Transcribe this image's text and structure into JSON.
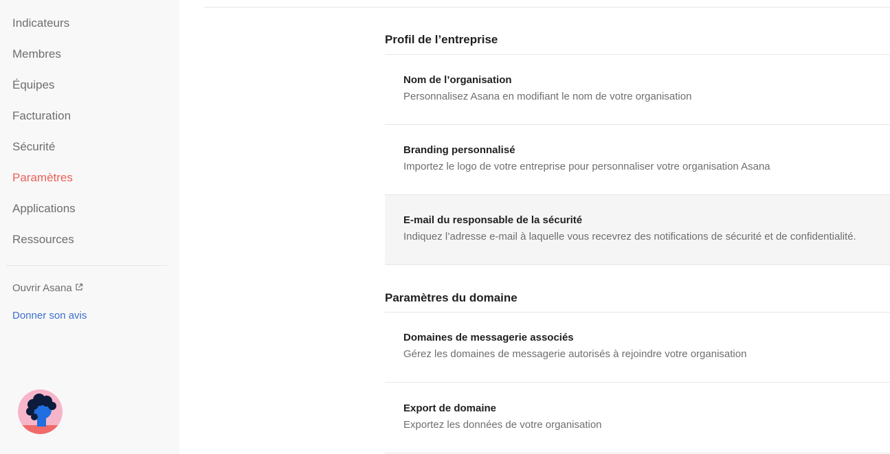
{
  "sidebar": {
    "items": [
      {
        "label": "Indicateurs",
        "active": false
      },
      {
        "label": "Membres",
        "active": false
      },
      {
        "label": "Équipes",
        "active": false
      },
      {
        "label": "Facturation",
        "active": false
      },
      {
        "label": "Sécurité",
        "active": false
      },
      {
        "label": "Paramètres",
        "active": true
      },
      {
        "label": "Applications",
        "active": false
      },
      {
        "label": "Ressources",
        "active": false
      }
    ],
    "open_link": "Ouvrir Asana",
    "feedback_link": "Donner son avis"
  },
  "sections": [
    {
      "title": "Profil de l’entreprise",
      "rows": [
        {
          "title": "Nom de l’organisation",
          "description": "Personnalisez Asana en modifiant le nom de votre organisation"
        },
        {
          "title": "Branding personnalisé",
          "description": "Importez le logo de votre entreprise pour personnaliser votre organisation Asana"
        },
        {
          "title": "E-mail du responsable de la sécurité",
          "description": "Indiquez l’adresse e-mail à laquelle vous recevrez des notifications de sécurité et de confidentialité."
        }
      ]
    },
    {
      "title": "Paramètres du domaine",
      "rows": [
        {
          "title": "Domaines de messagerie associés",
          "description": "Gérez les domaines de messagerie autorisés à rejoindre votre organisation"
        },
        {
          "title": "Export de domaine",
          "description": "Exportez les données de votre organisation"
        }
      ]
    }
  ],
  "colors": {
    "active_nav": "#e8615a",
    "link": "#3a6fcf",
    "sidebar_bg": "#f9f8f8"
  }
}
